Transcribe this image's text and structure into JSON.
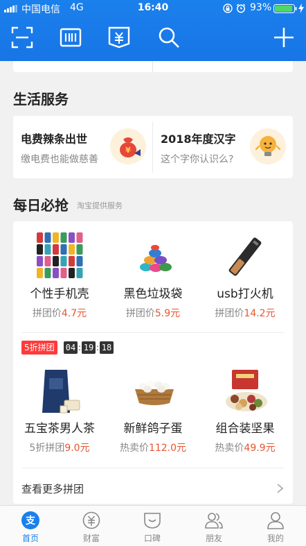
{
  "status_bar": {
    "carrier": "中国电信",
    "network": "4G",
    "time": "16:40",
    "battery_percent": "93%",
    "battery_level": 0.93
  },
  "top_nav": {
    "icons": [
      "scan-icon",
      "barcode-icon",
      "payment-code-icon",
      "search-icon",
      "plus-icon"
    ]
  },
  "life_services": {
    "title": "生活服务",
    "items": [
      {
        "title": "电费辣条出世",
        "subtitle": "缴电费也能做慈善",
        "icon": "money-bag-icon"
      },
      {
        "title": "2018年度汉字",
        "subtitle": "这个字你认识么?",
        "icon": "lightbulb-icon"
      }
    ]
  },
  "daily_deals": {
    "title": "每日必抢",
    "subtitle": "淘宝提供服务",
    "row1": [
      {
        "name": "个性手机壳",
        "price_label": "拼团价",
        "price": "4.7元"
      },
      {
        "name": "黑色垃圾袋",
        "price_label": "拼团价",
        "price": "5.9元"
      },
      {
        "name": "usb打火机",
        "price_label": "拼团价",
        "price": "14.2元"
      }
    ],
    "flash_badge": "5折拼团",
    "countdown": {
      "hours": "04",
      "minutes": "19",
      "seconds": "18"
    },
    "row2": [
      {
        "name": "五宝茶男人茶",
        "price_label": "5折拼团",
        "price": "9.0元"
      },
      {
        "name": "新鲜鸽子蛋",
        "price_label": "热卖价",
        "price": "112.0元"
      },
      {
        "name": "组合装坚果",
        "price_label": "热卖价",
        "price": "49.9元"
      }
    ],
    "more_link": "查看更多拼团"
  },
  "tab_bar": {
    "tabs": [
      {
        "label": "首页",
        "icon": "alipay-icon",
        "active": true
      },
      {
        "label": "财富",
        "icon": "wealth-icon",
        "active": false
      },
      {
        "label": "口碑",
        "icon": "koubei-icon",
        "active": false
      },
      {
        "label": "朋友",
        "icon": "friends-icon",
        "active": false
      },
      {
        "label": "我的",
        "icon": "profile-icon",
        "active": false
      }
    ]
  },
  "colors": {
    "brand_blue": "#1a80ec",
    "price_red": "#e8542f",
    "badge_red": "#ff3a3a"
  }
}
